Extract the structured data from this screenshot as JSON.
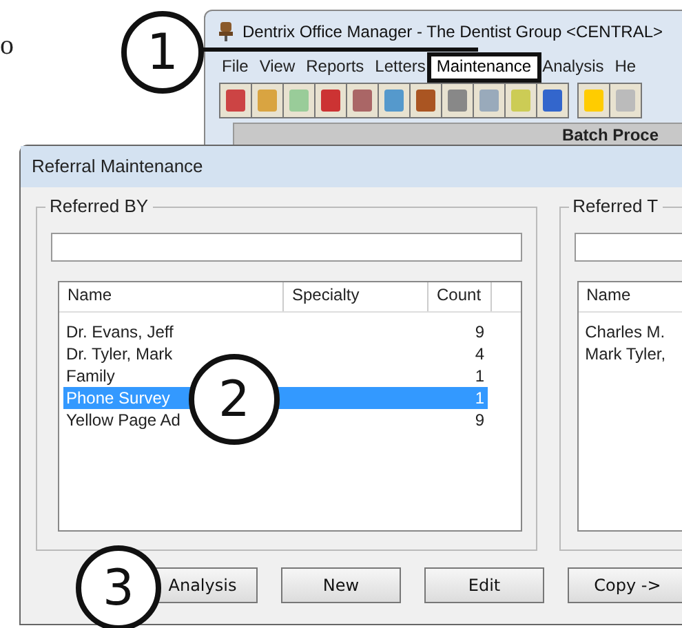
{
  "page_fragment": "o",
  "main_window": {
    "title": "Dentrix Office Manager - The Dentist Group <CENTRAL>",
    "menu": [
      {
        "label": "File",
        "selected": false
      },
      {
        "label": "View",
        "selected": false
      },
      {
        "label": "Reports",
        "selected": false
      },
      {
        "label": "Letters",
        "selected": false
      },
      {
        "label": "Maintenance",
        "selected": true
      },
      {
        "label": "Analysis",
        "selected": false
      },
      {
        "label": "He",
        "selected": false
      }
    ],
    "panel_title": "Batch Proce"
  },
  "dialog": {
    "title": "Referral Maintenance",
    "referred_by": {
      "label": "Referred BY",
      "columns": [
        "Name",
        "Specialty",
        "Count"
      ],
      "rows": [
        {
          "name": "Dr. Evans, Jeff",
          "count": "9",
          "selected": false
        },
        {
          "name": "Dr. Tyler, Mark",
          "count": "4",
          "selected": false
        },
        {
          "name": "Family",
          "count": "1",
          "selected": false
        },
        {
          "name": "Phone Survey",
          "count": "1",
          "selected": true
        },
        {
          "name": "Yellow Page Ad",
          "count": "9",
          "selected": false
        }
      ]
    },
    "referred_to": {
      "label": "Referred T",
      "columns": [
        "Name"
      ],
      "rows": [
        "Charles M.",
        "Mark Tyler,"
      ]
    },
    "buttons": [
      "Analysis",
      "New",
      "Edit",
      "Copy ->"
    ]
  },
  "callouts": [
    "1",
    "2",
    "3"
  ]
}
